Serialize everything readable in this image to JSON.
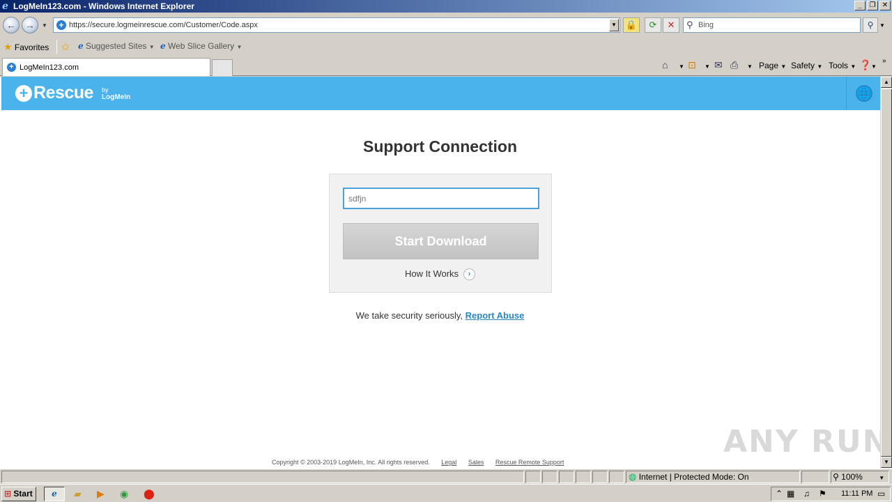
{
  "window": {
    "title": "LogMeIn123.com - Windows Internet Explorer",
    "minimize": "_",
    "restore": "❐",
    "close": "✕"
  },
  "address_bar": {
    "url": "https://secure.logmeinrescue.com/Customer/Code.aspx",
    "search_placeholder": "Bing"
  },
  "favorites_bar": {
    "favorites_label": "Favorites",
    "suggested_sites": "Suggested Sites",
    "web_slice_gallery": "Web Slice Gallery"
  },
  "tab": {
    "label": "LogMeIn123.com"
  },
  "command_bar": {
    "page": "Page",
    "safety": "Safety",
    "tools": "Tools"
  },
  "header": {
    "logo_text": "Rescue",
    "logo_by": "by",
    "logo_brand": "LogMeIn"
  },
  "main": {
    "title": "Support Connection",
    "code_value": "sdfjn",
    "start_button": "Start Download",
    "how_it_works": "How It Works",
    "security_text": "We take security seriously,",
    "report_abuse": "Report Abuse"
  },
  "footer": {
    "copyright": "Copyright © 2003-2019 LogMeIn, Inc. All rights reserved.",
    "legal": "Legal",
    "sales": "Sales",
    "remote_support": "Rescue Remote Support"
  },
  "watermark": "ANY RUN",
  "status_bar": {
    "zone": "Internet | Protected Mode: On",
    "zoom": "100%"
  },
  "taskbar": {
    "start": "Start",
    "clock": "11:11 PM"
  },
  "colors": {
    "rescue_blue": "#4ab3ec",
    "link_blue": "#2a86c0",
    "input_border": "#4aa0d8",
    "button_gray": "#c8c8c8"
  },
  "icons": [
    "ie-icon",
    "back-icon",
    "forward-icon",
    "site-icon",
    "lock-icon",
    "refresh-icon",
    "stop-icon",
    "search-icon",
    "favorites-star-icon",
    "add-favorites-icon",
    "home-icon",
    "rss-icon",
    "mail-icon",
    "print-icon",
    "help-icon",
    "globe-icon",
    "rescue-plus-icon",
    "arrow-right-icon",
    "windows-flag-icon",
    "folder-icon",
    "media-player-icon",
    "chrome-icon",
    "opera-icon"
  ]
}
